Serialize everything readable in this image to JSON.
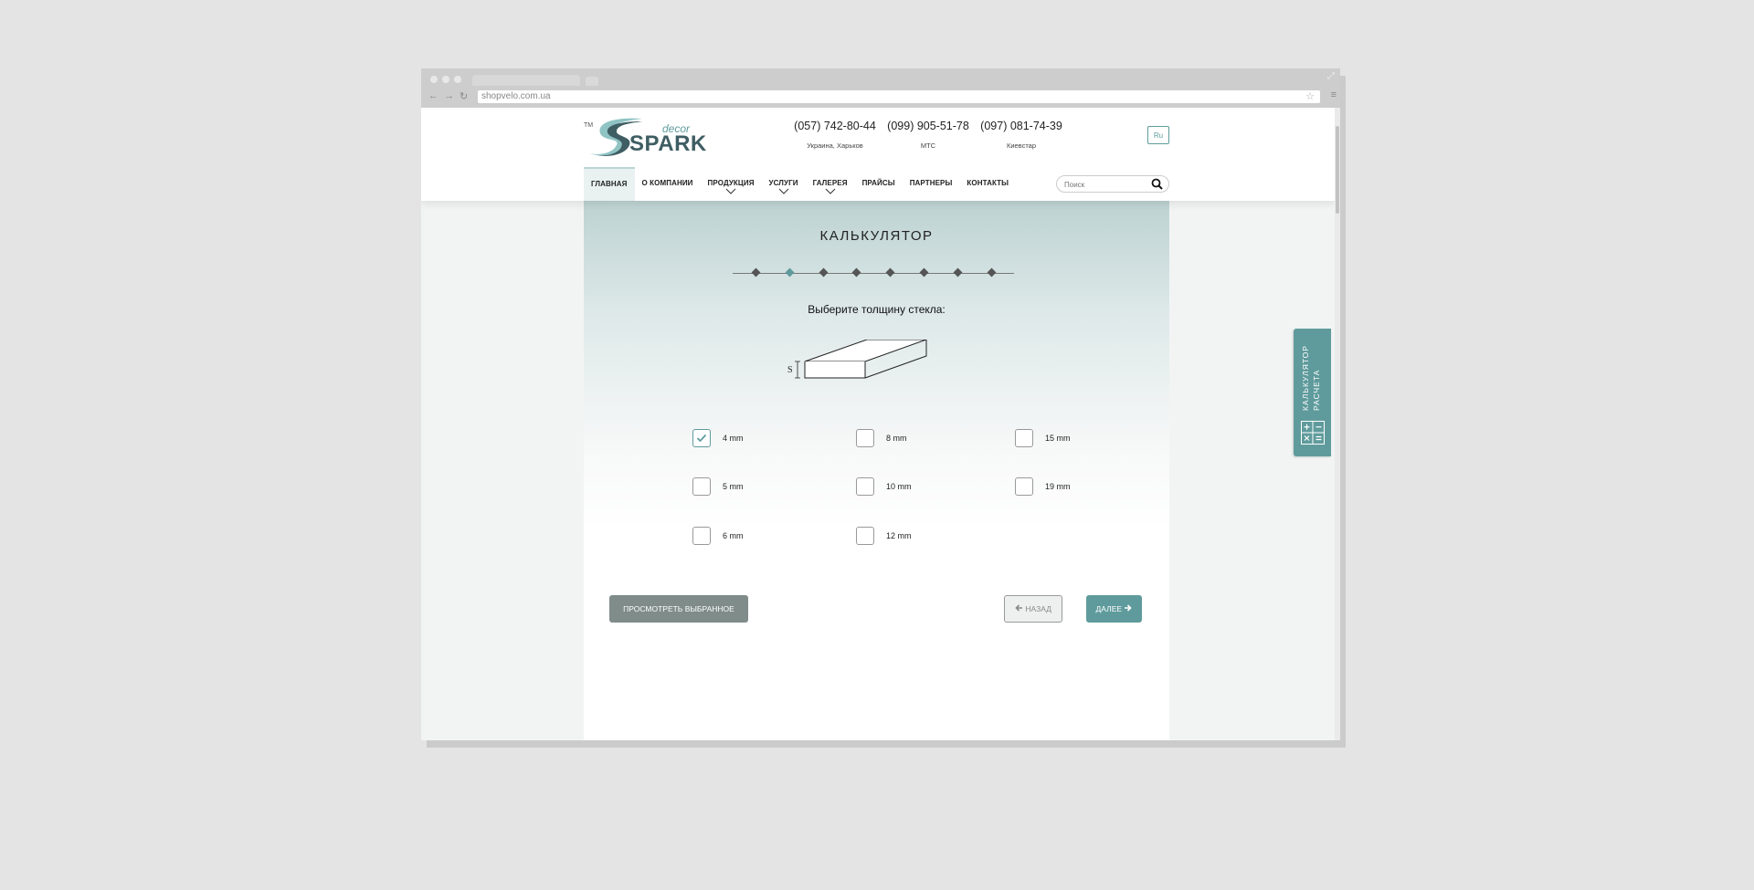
{
  "browser": {
    "url": "shopvelo.com.ua"
  },
  "header": {
    "logo": {
      "tm": "TM",
      "decor": "decor",
      "brand": "SPARK"
    },
    "phones": [
      {
        "number": "(057) 742-80-44",
        "label": "Украина, Харьков"
      },
      {
        "number": "(099) 905-51-78",
        "label": "МТС"
      },
      {
        "number": "(097) 081-74-39",
        "label": "Киевстар"
      }
    ],
    "lang": "Ru",
    "nav": [
      {
        "label": "ГЛАВНАЯ",
        "active": true
      },
      {
        "label": "О КОМПАНИИ"
      },
      {
        "label": "ПРОДУКЦИЯ",
        "dropdown": true
      },
      {
        "label": "УСЛУГИ",
        "dropdown": true
      },
      {
        "label": "ГАЛЕРЕЯ",
        "dropdown": true
      },
      {
        "label": "ПРАЙСЫ"
      },
      {
        "label": "ПАРТНЕРЫ"
      },
      {
        "label": "КОНТАКТЫ"
      }
    ],
    "search_placeholder": "Поиск"
  },
  "calculator": {
    "title": "КАЛЬКУЛЯТОР",
    "steps_total": 8,
    "active_step": 2,
    "question": "Выберите толщину стекла:",
    "diagram_label": "S",
    "options": [
      {
        "label": "4 mm",
        "checked": true
      },
      {
        "label": "5 mm",
        "checked": false
      },
      {
        "label": "6 mm",
        "checked": false
      },
      {
        "label": "8 mm",
        "checked": false
      },
      {
        "label": "10 mm",
        "checked": false
      },
      {
        "label": "12 mm",
        "checked": false
      },
      {
        "label": "15 mm",
        "checked": false
      },
      {
        "label": "19 mm",
        "checked": false
      }
    ],
    "buttons": {
      "view_selected": "ПРОСМОТРЕТЬ ВЫБРАННОЕ",
      "back": "НАЗАД",
      "next": "ДАЛЕЕ"
    }
  },
  "side_tab": {
    "line1": "КАЛЬКУЛЯТОР",
    "line2": "РАСЧЕТА"
  },
  "colors": {
    "accent": "#5f9b9c",
    "dark_button": "#7f8c8a",
    "brand_dark": "#3f5e63"
  }
}
